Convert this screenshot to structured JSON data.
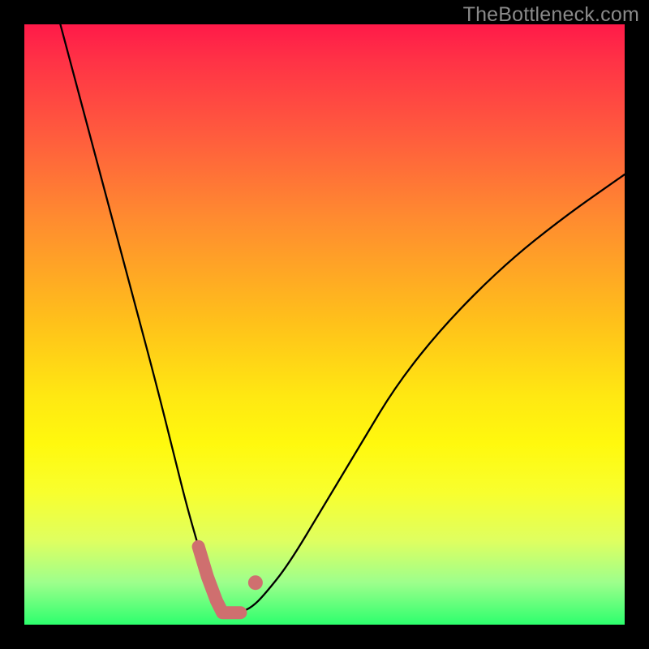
{
  "watermark": "TheBottleneck.com",
  "gradient_css": "linear-gradient(to bottom, #ff1a49 0%, #ff3246 6%, #ff5a3e 18%, #ff8a30 32%, #ffc21a 50%, #ffe812 62%, #fff90e 70%, #f8ff2e 78%, #dfff60 86%, #9dff8c 93%, #2dff6d 100%)",
  "colors": {
    "curve": "#000000",
    "marker": "#cf6f6f",
    "background": "#000000"
  },
  "chart_data": {
    "type": "line",
    "title": "",
    "xlabel": "",
    "ylabel": "",
    "xlim": [
      0,
      100
    ],
    "ylim": [
      0,
      100
    ],
    "grid": false,
    "legend": "none",
    "series": [
      {
        "name": "bottleneck-curve",
        "x": [
          6,
          10,
          14,
          18,
          22,
          25,
          27,
          29,
          30.5,
          32,
          33,
          34,
          36,
          38,
          40,
          44,
          50,
          56,
          62,
          70,
          80,
          90,
          100
        ],
        "values": [
          100,
          85,
          70,
          55,
          40,
          28,
          20,
          13,
          8,
          4,
          2,
          2,
          2,
          3,
          5,
          10,
          20,
          30,
          40,
          50,
          60,
          68,
          75
        ]
      }
    ],
    "annotations": [
      {
        "type": "range-marker",
        "name": "optimal-zone",
        "x_range": [
          29,
          37
        ],
        "y_approx": 2
      },
      {
        "type": "dot",
        "name": "curve-dot",
        "x": 38.5,
        "y": 7
      }
    ]
  }
}
